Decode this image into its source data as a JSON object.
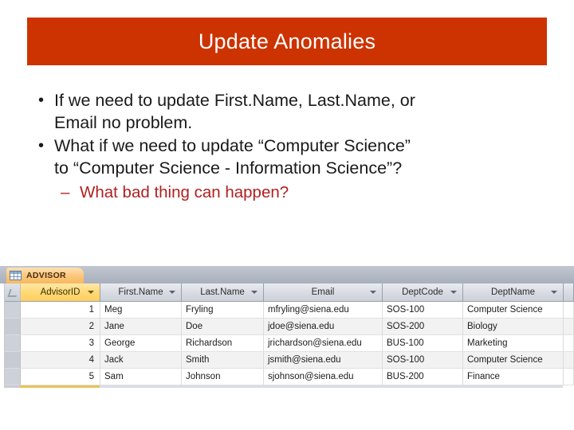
{
  "slide": {
    "title": "Update Anomalies",
    "title_bar_color": "#cc3300",
    "title_text_color": "#ffffff"
  },
  "body": {
    "bullet_marker_level1": "•",
    "bullet_marker_level2": "–",
    "bullets": [
      {
        "level": 1,
        "text": "If we need to update First.Name, Last.Name, or Email no problem.",
        "line1": "If we need to update First.Name, Last.Name, or",
        "line2": "Email no problem."
      },
      {
        "level": 1,
        "text": "What if we need to update “Computer Science” to “Computer Science - Information Science”?",
        "line1": "What if we need to update “Computer Science”",
        "line2": "to “Computer Science - Information Science”?"
      },
      {
        "level": 2,
        "text": "What bad thing can happen?",
        "color": "#b02020"
      }
    ]
  },
  "datasheet": {
    "tab": {
      "label": "ADVISOR",
      "icon": "table-icon"
    },
    "columns": [
      {
        "key": "advisor_id",
        "label": "AdvisorID",
        "primary_key": true
      },
      {
        "key": "first_name",
        "label": "First.Name",
        "primary_key": false
      },
      {
        "key": "last_name",
        "label": "Last.Name",
        "primary_key": false
      },
      {
        "key": "email",
        "label": "Email",
        "primary_key": false
      },
      {
        "key": "dept_code",
        "label": "DeptCode",
        "primary_key": false
      },
      {
        "key": "dept_name",
        "label": "DeptName",
        "primary_key": false
      }
    ],
    "rows": [
      {
        "advisor_id": "1",
        "first_name": "Meg",
        "last_name": "Fryling",
        "email": "mfryling@siena.edu",
        "dept_code": "SOS-100",
        "dept_name": "Computer Science"
      },
      {
        "advisor_id": "2",
        "first_name": "Jane",
        "last_name": "Doe",
        "email": "jdoe@siena.edu",
        "dept_code": "SOS-200",
        "dept_name": "Biology"
      },
      {
        "advisor_id": "3",
        "first_name": "George",
        "last_name": "Richardson",
        "email": "jrichardson@siena.edu",
        "dept_code": "BUS-100",
        "dept_name": "Marketing"
      },
      {
        "advisor_id": "4",
        "first_name": "Jack",
        "last_name": "Smith",
        "email": "jsmith@siena.edu",
        "dept_code": "SOS-100",
        "dept_name": "Computer Science"
      },
      {
        "advisor_id": "5",
        "first_name": "Sam",
        "last_name": "Johnson",
        "email": "sjohnson@siena.edu",
        "dept_code": "BUS-200",
        "dept_name": "Finance"
      }
    ]
  }
}
